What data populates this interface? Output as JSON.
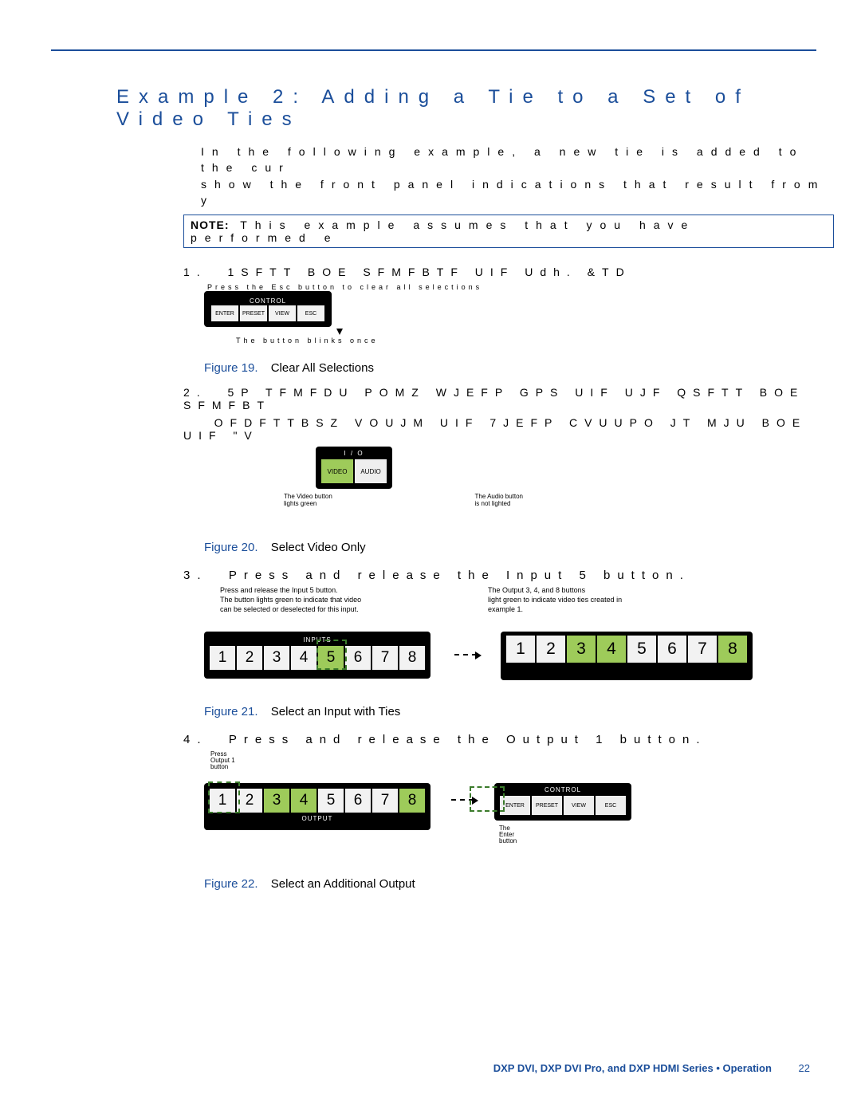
{
  "title": "Example 2: Adding a Tie to a Set of Video Ties",
  "intro_line1": "In the following example, a new tie is added to the cur",
  "intro_line2": "show the front panel indications that result from y",
  "note_label": "NOTE:",
  "note_text": "This example assumes that you have performed e",
  "step1_num": "1.",
  "step1_text": "1SFTT BOE SFMFBTF UIF Udh. &TD",
  "step1_press": "Press the Esc button to clear all selections",
  "panel_control": "CONTROL",
  "btns_control": [
    "ENTER",
    "PRESET",
    "VIEW",
    "ESC"
  ],
  "step1_blinks": "The button blinks once",
  "fig19_num": "Figure 19.",
  "fig19_txt": "Clear All Selections",
  "step2_num": "2.",
  "step2_line1": "5P TFMFDU POMZ WJEFP GPS UIF UJF  QSFTT BOE SFMFBT",
  "step2_line2": "OFDFTTBSZ  VOUJM UIF 7JEFP CVUUPO JT MJU BOE UIF \"V",
  "io_label": "I / O",
  "io_video": "VIDEO",
  "io_audio": "AUDIO",
  "io_note_video_a": "The Video button",
  "io_note_video_b": "lights green",
  "io_note_audio_a": "The Audio button",
  "io_note_audio_b": "is not lighted",
  "fig20_num": "Figure 20.",
  "fig20_txt": "Select Video Only",
  "step3_num": "3.",
  "step3_text": "Press and release the Input 5 button.",
  "step3_call1a": "Press and release the Input 5 button.",
  "step3_call1b": "The button lights green to indicate that video",
  "step3_call1c": "can be selected or deselected for this input.",
  "step3_call2a": "The Output 3, 4, and 8 buttons",
  "step3_call2b": "light green to indicate video ties created in",
  "step3_call2c": "example 1.",
  "inputs_label": "INPUTS",
  "numbers": [
    "1",
    "2",
    "3",
    "4",
    "5",
    "6",
    "7",
    "8"
  ],
  "fig21_num": "Figure 21.",
  "fig21_txt": "Select an Input with Ties",
  "step4_num": "4.",
  "step4_text": "Press and release the Output 1 button.",
  "step4_tiny1": "Press",
  "step4_tiny2": "Output 1",
  "step4_tiny3": "button",
  "output_label": "OUTPUT",
  "ctrl_enter": "ENTER",
  "ctrl_preset": "PRESET",
  "ctrl_view": "VIEW",
  "ctrl_esc": "ESC",
  "step4_note1": "The",
  "step4_note2": "Enter",
  "step4_note3": "button",
  "fig22_num": "Figure 22.",
  "fig22_txt": "Select an Additional Output",
  "footer_bold": "DXP DVI, DXP DVI Pro, and DXP HDMI Series • Operation",
  "footer_page": "22"
}
